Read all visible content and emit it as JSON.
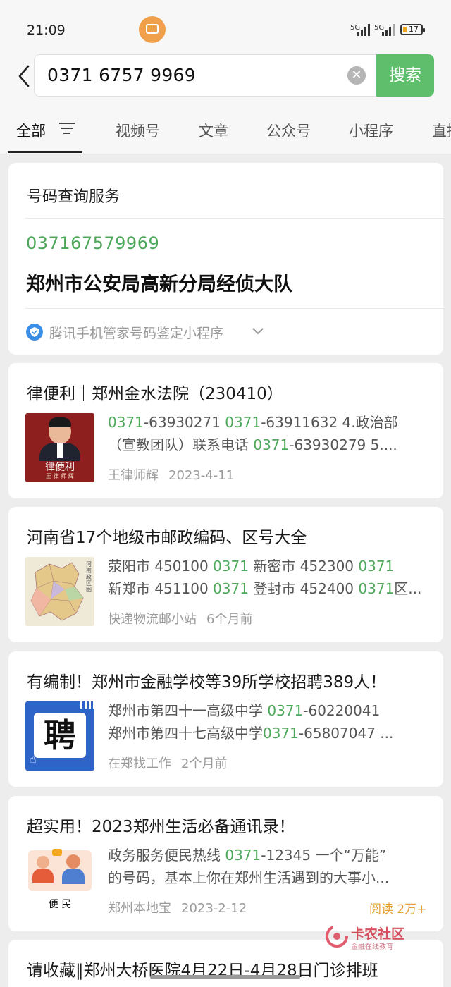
{
  "status": {
    "time": "21:09",
    "sig1": "5G",
    "sig2": "5G",
    "battery": "17"
  },
  "search": {
    "query": "0371 6757 9969",
    "button": "搜索"
  },
  "tabs": [
    {
      "label": "全部"
    },
    {
      "label": "视频号"
    },
    {
      "label": "文章"
    },
    {
      "label": "公众号"
    },
    {
      "label": "小程序"
    },
    {
      "label": "直播"
    }
  ],
  "lookup": {
    "header": "号码查询服务",
    "number": "037167579969",
    "owner": "郑州市公安局高新分局经侦大队",
    "footer": "腾讯手机管家号码鉴定小程序"
  },
  "results": [
    {
      "title": "律便利｜郑州金水法院（230410）",
      "thumb_label": "律便利",
      "thumb_sub": "王 律 师 辉",
      "line1": [
        [
          "g",
          "0371"
        ],
        [
          "n",
          "-63930271 "
        ],
        [
          "g",
          "0371"
        ],
        [
          "n",
          "-63911632 4.政治部"
        ]
      ],
      "line2": [
        [
          "n",
          "（宣教团队）联系电话 "
        ],
        [
          "g",
          "0371"
        ],
        [
          "n",
          "-63930279 5...."
        ]
      ],
      "source": "王律师辉",
      "time": "2023-4-11"
    },
    {
      "title": "河南省17个地级市邮政编码、区号大全",
      "thumb_label": "河南政区图",
      "line1": [
        [
          "n",
          "荥阳市 450100 "
        ],
        [
          "g",
          "0371"
        ],
        [
          "n",
          " 新密市 452300 "
        ],
        [
          "g",
          "0371"
        ]
      ],
      "line2": [
        [
          "n",
          "新郑市 451100 "
        ],
        [
          "g",
          "0371"
        ],
        [
          "n",
          " 登封市 452400 "
        ],
        [
          "g",
          "0371"
        ],
        [
          "n",
          "区..."
        ]
      ],
      "source": "快递物流邮小站",
      "time": "6个月前"
    },
    {
      "title": "有编制！郑州市金融学校等39所学校招聘389人！",
      "thumb_label": "聘",
      "line1": [
        [
          "n",
          "郑州市第四十一高级中学 "
        ],
        [
          "g",
          "0371"
        ],
        [
          "n",
          "-60220041"
        ]
      ],
      "line2": [
        [
          "n",
          "郑州市第四十七高级中学"
        ],
        [
          "g",
          "0371"
        ],
        [
          "n",
          "-65807047 ..."
        ]
      ],
      "source": "在郑找工作",
      "time": "2个月前"
    },
    {
      "title": "超实用！2023郑州生活必备通讯录！",
      "thumb_label": "便 民",
      "line1": [
        [
          "n",
          "政务服务便民热线 "
        ],
        [
          "g",
          "0371"
        ],
        [
          "n",
          "-12345 一个“万能”"
        ]
      ],
      "line2": [
        [
          "n",
          "的号码，基本上你在郑州生活遇到的大事小..."
        ]
      ],
      "source": "郑州本地宝",
      "time": "2023-2-12",
      "reads": "阅读 2万+"
    }
  ],
  "partial": {
    "title": "请收藏‖郑州大桥医院4月22日-4月28日门诊排班"
  },
  "watermark": {
    "main": "卡农社区",
    "sub": "金融在线教育"
  },
  "colors": {
    "accent": "#5ebe6b",
    "highlight": "#4ea85a",
    "reads": "#e6a035"
  }
}
